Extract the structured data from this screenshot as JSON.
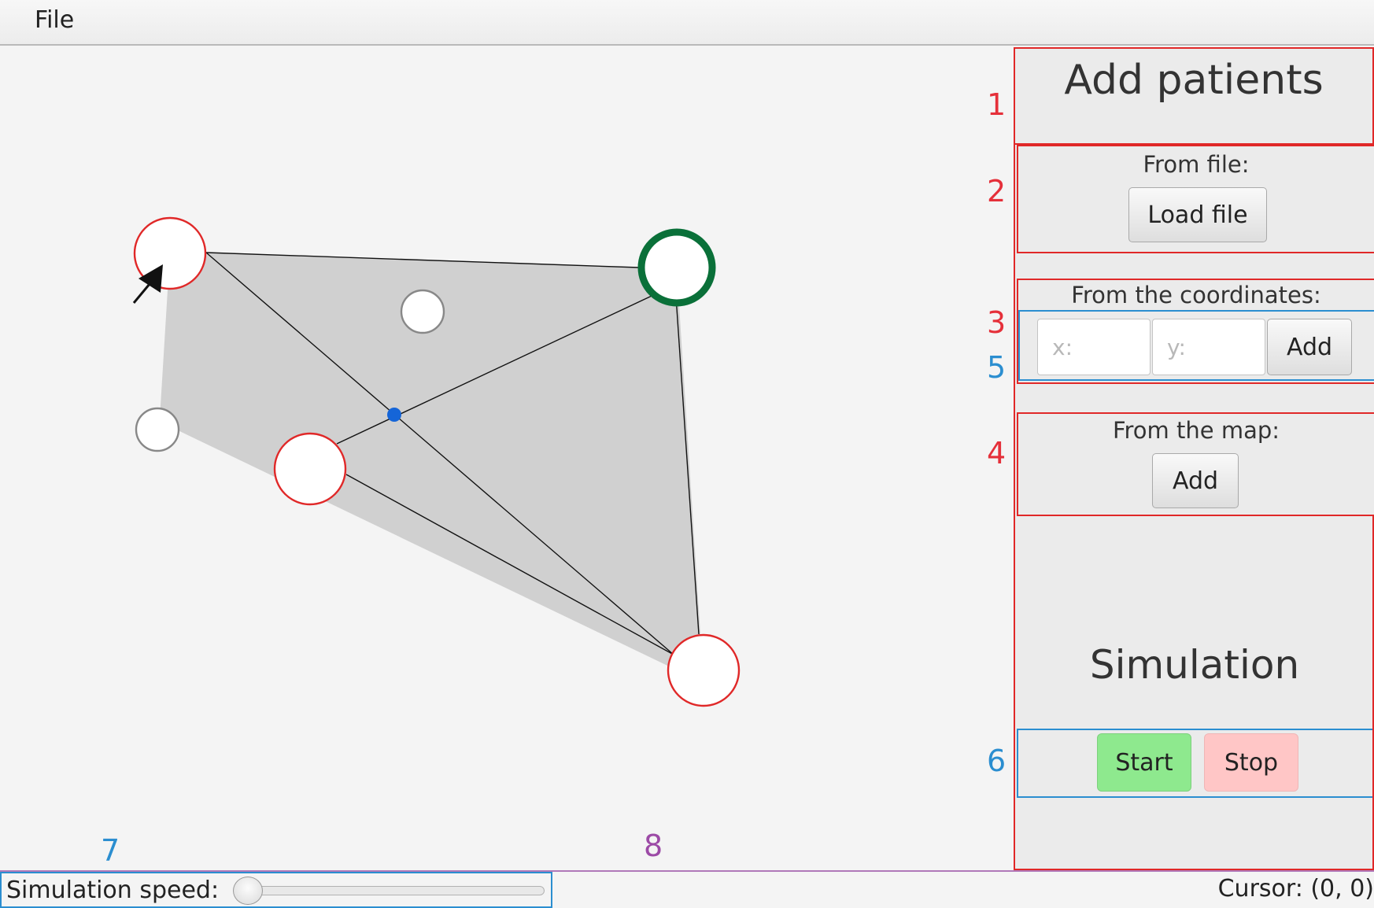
{
  "menu": {
    "file_label": "File"
  },
  "panel": {
    "add_patients_title": "Add patients",
    "from_file_label": "From file:",
    "load_file_label": "Load file",
    "from_coordinates_label": "From the coordinates:",
    "x_placeholder": "x:",
    "y_placeholder": "y:",
    "x_value": "",
    "y_value": "",
    "add_coordinates_label": "Add",
    "from_map_label": "From the map:",
    "add_map_label": "Add",
    "simulation_title": "Simulation",
    "start_label": "Start",
    "stop_label": "Stop"
  },
  "annotations": [
    "1",
    "2",
    "3",
    "4",
    "5",
    "6",
    "7",
    "8"
  ],
  "status": {
    "speed_label": "Simulation speed:",
    "speed_value": 0,
    "cursor_text": "Cursor: (0, 0)"
  },
  "colors": {
    "outline_red": "#e02828",
    "outline_blue": "#2b8ed0",
    "outline_purple": "#b079b9",
    "start_green": "#8ee98e",
    "stop_pink": "#ffc6c6",
    "hospital_green": "#0a7039",
    "center_dot_blue": "#1565d8",
    "hull_gray": "#d0d0d0"
  },
  "map": {
    "node_legend": [
      "patient-red",
      "hospital-green",
      "vertex-gray",
      "center-blue"
    ],
    "cursor_icon": "arrow-cursor-icon"
  }
}
